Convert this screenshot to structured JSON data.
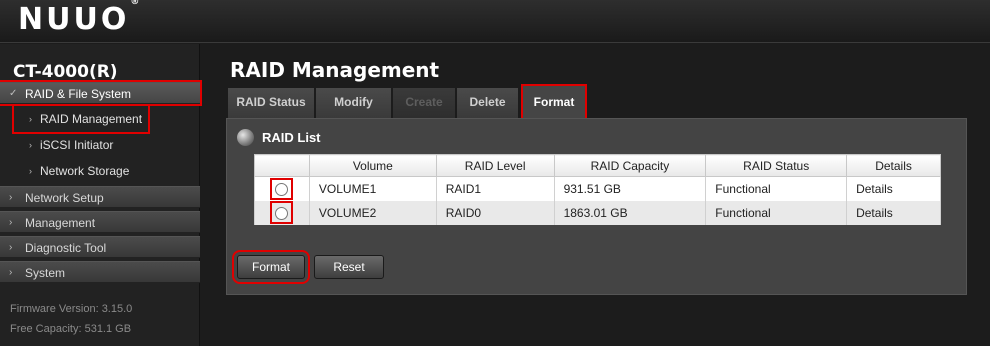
{
  "header": {
    "logo": "NUUO",
    "logo_mark": "®"
  },
  "sidebar": {
    "device_name": "CT-4000(R)",
    "sections": [
      {
        "label": "RAID & File System",
        "open": true,
        "items": [
          {
            "label": "RAID Management"
          },
          {
            "label": "iSCSI Initiator"
          },
          {
            "label": "Network Storage"
          }
        ]
      },
      {
        "label": "Network Setup"
      },
      {
        "label": "Management"
      },
      {
        "label": "Diagnostic Tool"
      },
      {
        "label": "System"
      }
    ],
    "firmware": "Firmware Version: 3.15.0",
    "free_capacity": "Free Capacity: 531.1 GB"
  },
  "main": {
    "title": "RAID Management",
    "tabs": [
      {
        "label": "RAID Status",
        "state": "normal"
      },
      {
        "label": "Modify",
        "state": "normal"
      },
      {
        "label": "Create",
        "state": "disabled"
      },
      {
        "label": "Delete",
        "state": "normal"
      },
      {
        "label": "Format",
        "state": "active"
      }
    ],
    "panel_title": "RAID List",
    "table": {
      "columns": [
        "Volume",
        "RAID Level",
        "RAID Capacity",
        "RAID Status",
        "Details"
      ],
      "rows": [
        {
          "volume": "VOLUME1",
          "level": "RAID1",
          "capacity": "931.51 GB",
          "status": "Functional",
          "details": "Details"
        },
        {
          "volume": "VOLUME2",
          "level": "RAID0",
          "capacity": "1863.01 GB",
          "status": "Functional",
          "details": "Details"
        }
      ]
    },
    "buttons": {
      "format": "Format",
      "reset": "Reset"
    }
  },
  "colors": {
    "highlight": "#e00000",
    "background": "#1c1c1c",
    "panel": "#444444"
  }
}
